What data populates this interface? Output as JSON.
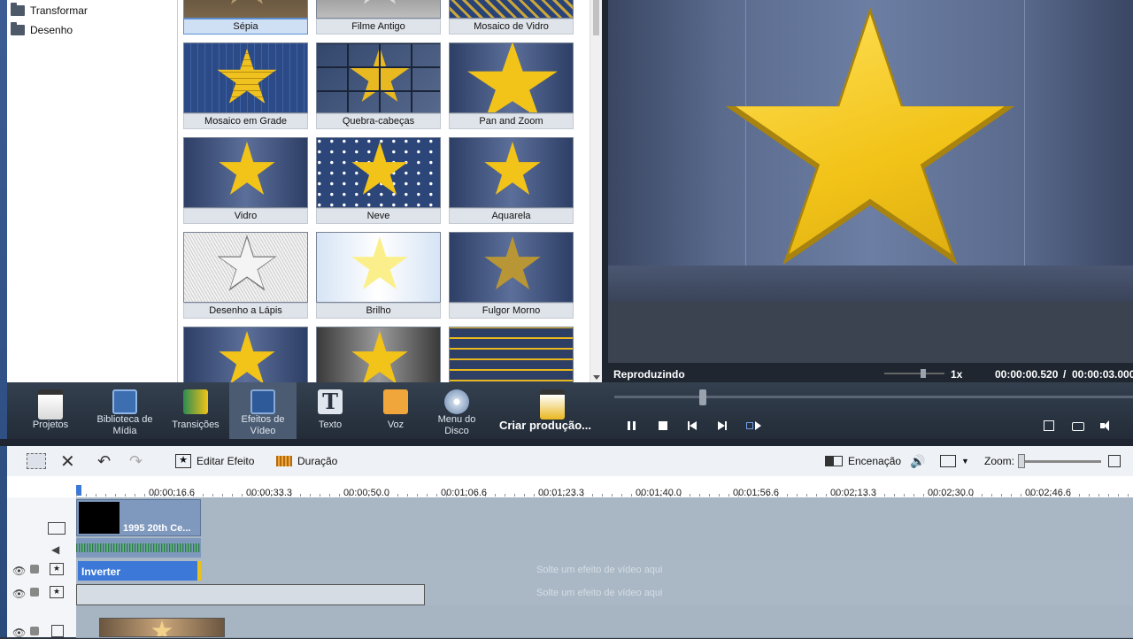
{
  "folders": [
    "Transformar",
    "Desenho"
  ],
  "effects": [
    {
      "label": "Sépia",
      "selected": true
    },
    {
      "label": "Filme Antigo"
    },
    {
      "label": "Mosaico de Vidro"
    },
    {
      "label": "Mosaico em Grade"
    },
    {
      "label": "Quebra-cabeças"
    },
    {
      "label": "Pan and Zoom"
    },
    {
      "label": "Vidro"
    },
    {
      "label": "Neve"
    },
    {
      "label": "Aquarela"
    },
    {
      "label": "Desenho a Lápis"
    },
    {
      "label": "Brilho"
    },
    {
      "label": "Fulgor Morno"
    }
  ],
  "preview": {
    "status": "Reproduzindo",
    "speed": "1x",
    "current_time": "00:00:00.520",
    "separator": "/",
    "total_time": "00:00:03.000",
    "progress": 0.17
  },
  "toolbar": {
    "projetos": "Projetos",
    "biblioteca": "Biblioteca de Mídia",
    "transicoes": "Transições",
    "efeitos": "Efeitos de Vídeo",
    "texto": "Texto",
    "voz": "Voz",
    "menu_disco": "Menu do Disco",
    "criar": "Criar produção..."
  },
  "timeline_toolbar": {
    "editar_efeito": "Editar Efeito",
    "duracao": "Duração",
    "encenacao": "Encenação",
    "zoom": "Zoom:"
  },
  "ruler": [
    "00:00:16.6",
    "00:00:33.3",
    "00:00:50.0",
    "00:01:06.6",
    "00:01:23.3",
    "00:01:40.0",
    "00:01:56.6",
    "00:02:13.3",
    "00:02:30.0",
    "00:02:46.6"
  ],
  "tracks": {
    "video_clip": "1995 20th Ce...",
    "effect_clip": "Inverter",
    "drop_hint": "Solte um efeito de vídeo aqui"
  },
  "colors": {
    "accent": "#3b78d8",
    "toolbar_bg": "#2b3441",
    "star": "#f2c318"
  }
}
